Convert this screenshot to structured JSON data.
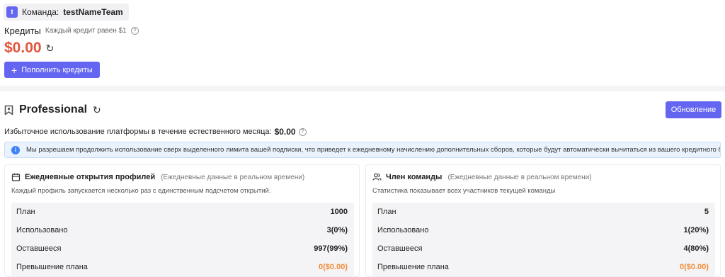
{
  "team": {
    "avatar_letter": "t",
    "label": "Команда:",
    "name": "testNameTeam"
  },
  "credits": {
    "label": "Кредиты",
    "hint": "Каждый кредит равен $1",
    "balance": "$0.00",
    "topup_label": "Пополнить кредиты"
  },
  "plan": {
    "title": "Professional",
    "update_label": "Обновление",
    "overuse_label": "Избыточное использование платформы в течение естественного месяца:",
    "overuse_value": "$0.00",
    "notice": "Мы разрешаем продолжить использование сверх выделенного лимита вашей подписки, что приведет к ежедневному начислению дополнительных сборов, которые будут автоматически вычитаться из вашего кредитного баланса."
  },
  "cards": [
    {
      "title": "Ежедневные открытия профилей",
      "subtitle": "(Ежедневные данные в реальном времени)",
      "description": "Каждый профиль запускается несколько раз с единственным подсчетом открытий.",
      "rows": [
        {
          "label": "План",
          "value": "1000"
        },
        {
          "label": "Использовано",
          "value": "3(0%)"
        },
        {
          "label": "Оставшееся",
          "value": "997(99%)"
        },
        {
          "label": "Превышение плана",
          "value": "0($0.00)"
        }
      ]
    },
    {
      "title": "Член команды",
      "subtitle": "(Ежедневные данные в реальном времени)",
      "description": "Статистика показывает всех участников текущей команды",
      "rows": [
        {
          "label": "План",
          "value": "5"
        },
        {
          "label": "Использовано",
          "value": "1(20%)"
        },
        {
          "label": "Оставшееся",
          "value": "4(80%)"
        },
        {
          "label": "Превышение плана",
          "value": "0($0.00)"
        }
      ]
    }
  ],
  "colors": {
    "accent": "#6466f1",
    "balance": "#e0563c",
    "overage": "#f08c3a",
    "info": "#3b82f6"
  },
  "icons": {
    "refresh": "refresh-icon",
    "help": "question-circle-icon",
    "plan": "bookmark-icon",
    "card1": "calendar-icon",
    "card2": "users-icon",
    "info": "info-icon"
  }
}
